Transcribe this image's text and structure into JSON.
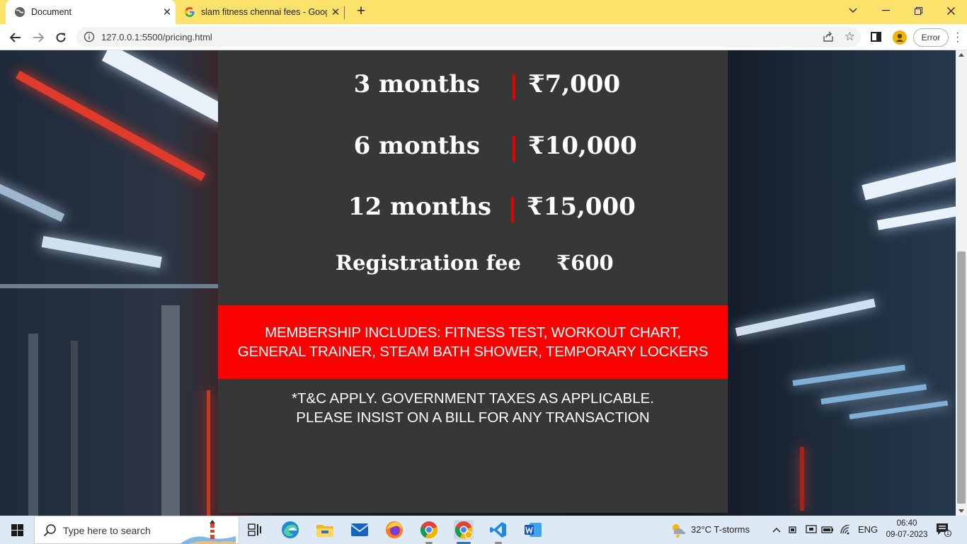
{
  "browser": {
    "tabs": [
      {
        "title": "Document",
        "active": true
      },
      {
        "title": "slam fitness chennai fees - Googl",
        "active": false
      }
    ],
    "url": "127.0.0.1:5500/pricing.html",
    "error_label": "Error"
  },
  "pricing": {
    "plans": [
      {
        "duration": "3 months",
        "price": "₹7,000"
      },
      {
        "duration": "6 months",
        "price": "₹10,000"
      },
      {
        "duration": "12 months",
        "price": "₹15,000"
      }
    ],
    "registration": {
      "label": "Registration fee",
      "price": "₹600"
    },
    "membership_line1": "MEMBERSHIP INCLUDES: FITNESS TEST, WORKOUT CHART,",
    "membership_line2": "GENERAL TRAINER, STEAM BATH SHOWER, TEMPORARY LOCKERS",
    "terms_line1": "*T&C APPLY. GOVERNMENT TAXES AS APPLICABLE.",
    "terms_line2": "PLEASE INSIST ON A BILL FOR ANY TRANSACTION",
    "colors": {
      "panel": "#373737",
      "accent_red": "#fb0202",
      "divider": "#e00000"
    }
  },
  "taskbar": {
    "search_placeholder": "Type here to search",
    "weather": "32°C  T-storms",
    "language": "ENG",
    "time": "06:40",
    "date": "09-07-2023",
    "notification_count": "1",
    "apps": [
      "task-view",
      "edge",
      "file-explorer",
      "mail",
      "firefox",
      "chrome",
      "chrome-profile",
      "vscode",
      "word"
    ]
  }
}
